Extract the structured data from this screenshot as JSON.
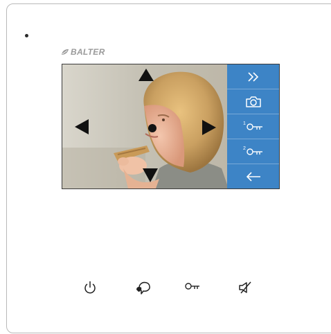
{
  "brand": {
    "name": "BALTER"
  },
  "camera": {
    "view": "camera-feed",
    "directional_controls": [
      "up",
      "down",
      "left",
      "right",
      "center"
    ]
  },
  "side_panel": {
    "buttons": [
      {
        "id": "forward",
        "icon": "double-chevron-right-icon"
      },
      {
        "id": "snapshot",
        "icon": "camera-icon"
      },
      {
        "id": "unlock1",
        "icon": "key-icon",
        "label": "1"
      },
      {
        "id": "unlock2",
        "icon": "key-icon",
        "label": "2"
      },
      {
        "id": "back",
        "icon": "arrow-left-icon"
      }
    ],
    "accent_color": "#3d84c6"
  },
  "hardware_buttons": [
    {
      "id": "power",
      "icon": "power-icon"
    },
    {
      "id": "talk",
      "icon": "talk-icon"
    },
    {
      "id": "key",
      "icon": "key-icon"
    },
    {
      "id": "mute",
      "icon": "mute-icon"
    }
  ]
}
